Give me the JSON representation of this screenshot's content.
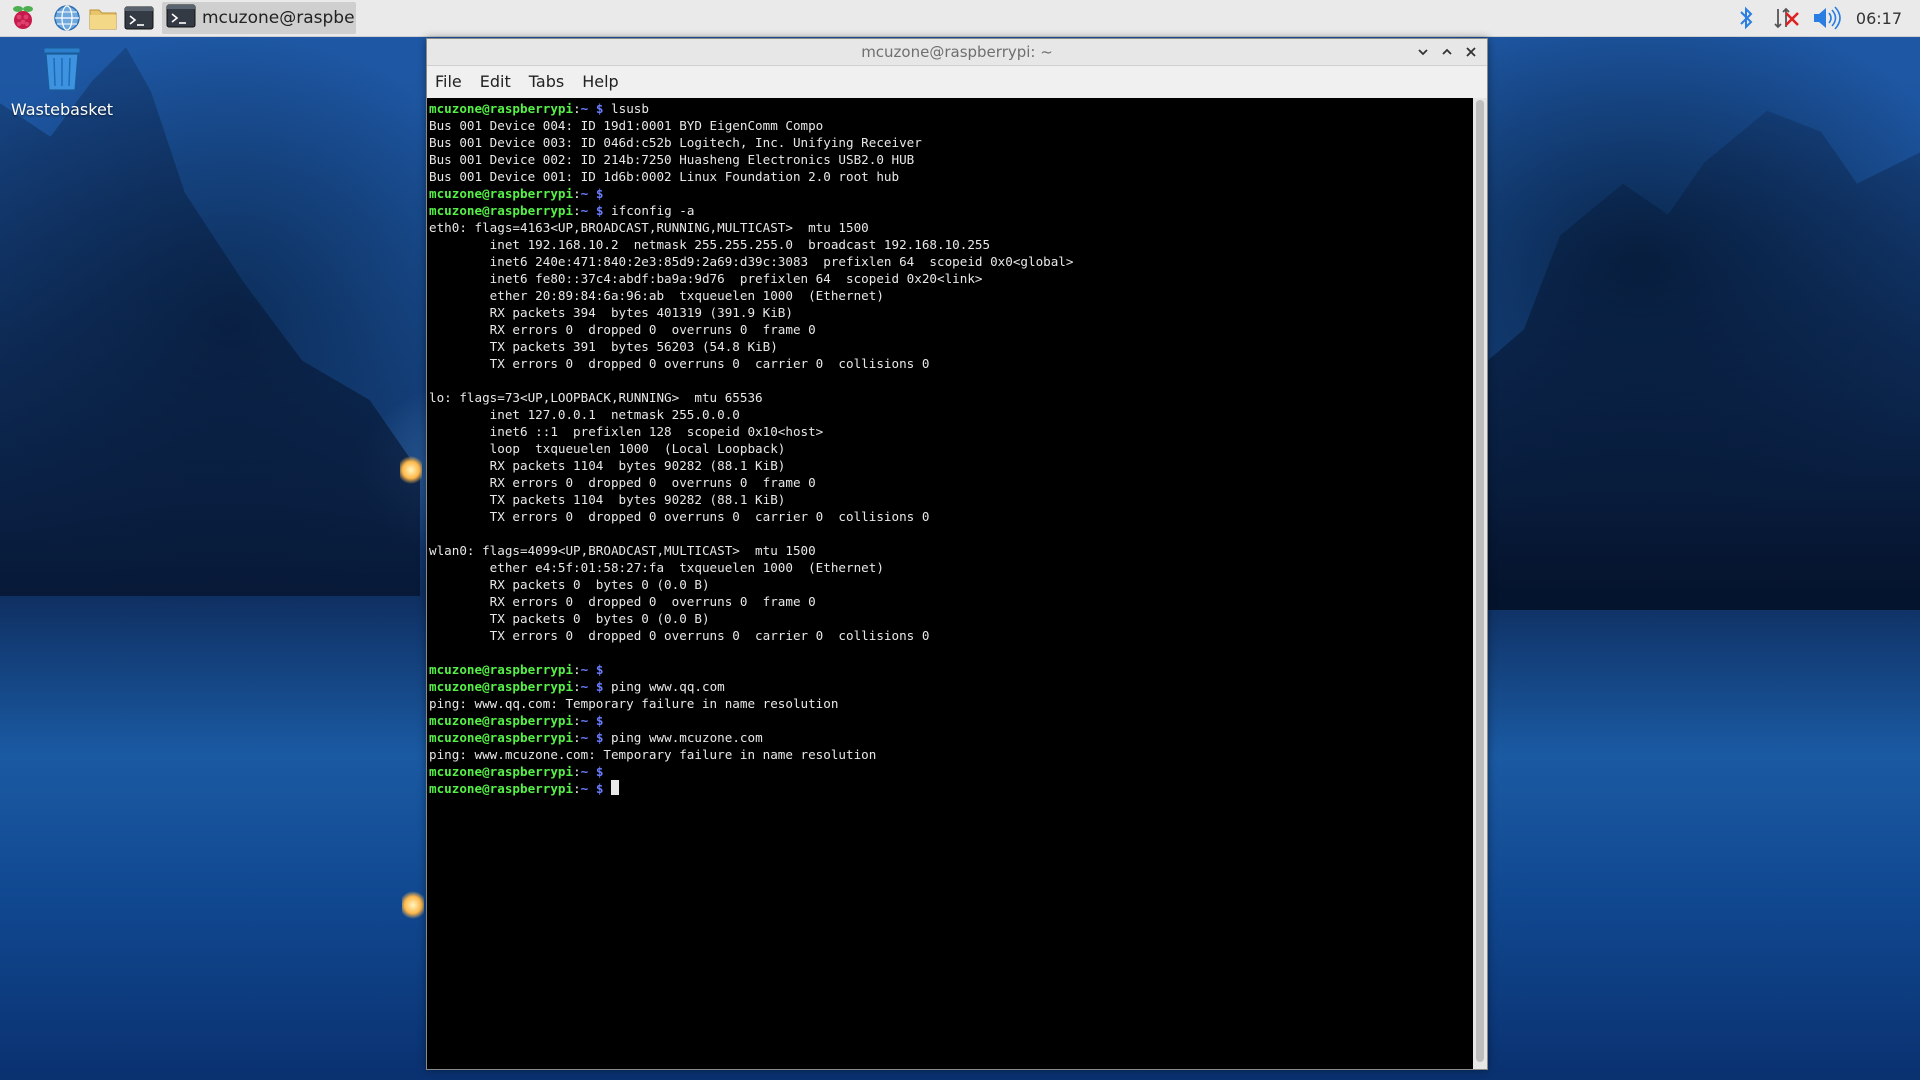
{
  "taskbar": {
    "launchers": [
      {
        "icon": "raspberry-pi-menu-icon"
      },
      {
        "icon": "web-browser-globe-icon"
      },
      {
        "icon": "file-manager-folder-icon"
      },
      {
        "icon": "terminal-icon"
      }
    ],
    "task": {
      "icon": "terminal-icon",
      "label": "mcuzone@raspberry..."
    },
    "tray": {
      "bluetooth_icon": "bluetooth-icon",
      "network_icon": "network-disconnected-icon",
      "volume_icon": "volume-icon",
      "clock": "06:17"
    }
  },
  "desktop": {
    "icons": [
      {
        "label": "Wastebasket",
        "icon": "wastebasket-icon"
      }
    ]
  },
  "window": {
    "title": "mcuzone@raspberrypi: ~",
    "menu": [
      "File",
      "Edit",
      "Tabs",
      "Help"
    ],
    "colors": {
      "prompt_user": "#56f048",
      "prompt_dir": "#6a7cff",
      "background": "#000000",
      "text": "#e8e8e8"
    },
    "prompt": {
      "user_host": "mcuzone@raspberrypi",
      "sep": ":",
      "dir": "~",
      "symbol": "$"
    },
    "lines": [
      {
        "type": "cmd",
        "cmd": "lsusb"
      },
      {
        "type": "out",
        "text": "Bus 001 Device 004: ID 19d1:0001 BYD EigenComm Compo"
      },
      {
        "type": "out",
        "text": "Bus 001 Device 003: ID 046d:c52b Logitech, Inc. Unifying Receiver"
      },
      {
        "type": "out",
        "text": "Bus 001 Device 002: ID 214b:7250 Huasheng Electronics USB2.0 HUB"
      },
      {
        "type": "out",
        "text": "Bus 001 Device 001: ID 1d6b:0002 Linux Foundation 2.0 root hub"
      },
      {
        "type": "cmd",
        "cmd": ""
      },
      {
        "type": "cmd",
        "cmd": "ifconfig -a"
      },
      {
        "type": "out",
        "text": "eth0: flags=4163<UP,BROADCAST,RUNNING,MULTICAST>  mtu 1500"
      },
      {
        "type": "out",
        "text": "        inet 192.168.10.2  netmask 255.255.255.0  broadcast 192.168.10.255"
      },
      {
        "type": "out",
        "text": "        inet6 240e:471:840:2e3:85d9:2a69:d39c:3083  prefixlen 64  scopeid 0x0<global>"
      },
      {
        "type": "out",
        "text": "        inet6 fe80::37c4:abdf:ba9a:9d76  prefixlen 64  scopeid 0x20<link>"
      },
      {
        "type": "out",
        "text": "        ether 20:89:84:6a:96:ab  txqueuelen 1000  (Ethernet)"
      },
      {
        "type": "out",
        "text": "        RX packets 394  bytes 401319 (391.9 KiB)"
      },
      {
        "type": "out",
        "text": "        RX errors 0  dropped 0  overruns 0  frame 0"
      },
      {
        "type": "out",
        "text": "        TX packets 391  bytes 56203 (54.8 KiB)"
      },
      {
        "type": "out",
        "text": "        TX errors 0  dropped 0 overruns 0  carrier 0  collisions 0"
      },
      {
        "type": "out",
        "text": ""
      },
      {
        "type": "out",
        "text": "lo: flags=73<UP,LOOPBACK,RUNNING>  mtu 65536"
      },
      {
        "type": "out",
        "text": "        inet 127.0.0.1  netmask 255.0.0.0"
      },
      {
        "type": "out",
        "text": "        inet6 ::1  prefixlen 128  scopeid 0x10<host>"
      },
      {
        "type": "out",
        "text": "        loop  txqueuelen 1000  (Local Loopback)"
      },
      {
        "type": "out",
        "text": "        RX packets 1104  bytes 90282 (88.1 KiB)"
      },
      {
        "type": "out",
        "text": "        RX errors 0  dropped 0  overruns 0  frame 0"
      },
      {
        "type": "out",
        "text": "        TX packets 1104  bytes 90282 (88.1 KiB)"
      },
      {
        "type": "out",
        "text": "        TX errors 0  dropped 0 overruns 0  carrier 0  collisions 0"
      },
      {
        "type": "out",
        "text": ""
      },
      {
        "type": "out",
        "text": "wlan0: flags=4099<UP,BROADCAST,MULTICAST>  mtu 1500"
      },
      {
        "type": "out",
        "text": "        ether e4:5f:01:58:27:fa  txqueuelen 1000  (Ethernet)"
      },
      {
        "type": "out",
        "text": "        RX packets 0  bytes 0 (0.0 B)"
      },
      {
        "type": "out",
        "text": "        RX errors 0  dropped 0  overruns 0  frame 0"
      },
      {
        "type": "out",
        "text": "        TX packets 0  bytes 0 (0.0 B)"
      },
      {
        "type": "out",
        "text": "        TX errors 0  dropped 0 overruns 0  carrier 0  collisions 0"
      },
      {
        "type": "out",
        "text": ""
      },
      {
        "type": "cmd",
        "cmd": ""
      },
      {
        "type": "cmd",
        "cmd": "ping www.qq.com"
      },
      {
        "type": "out",
        "text": "ping: www.qq.com: Temporary failure in name resolution"
      },
      {
        "type": "cmd",
        "cmd": ""
      },
      {
        "type": "cmd",
        "cmd": "ping www.mcuzone.com"
      },
      {
        "type": "out",
        "text": "ping: www.mcuzone.com: Temporary failure in name resolution"
      },
      {
        "type": "cmd",
        "cmd": ""
      },
      {
        "type": "cmd",
        "cmd": "",
        "cursor": true
      }
    ]
  }
}
